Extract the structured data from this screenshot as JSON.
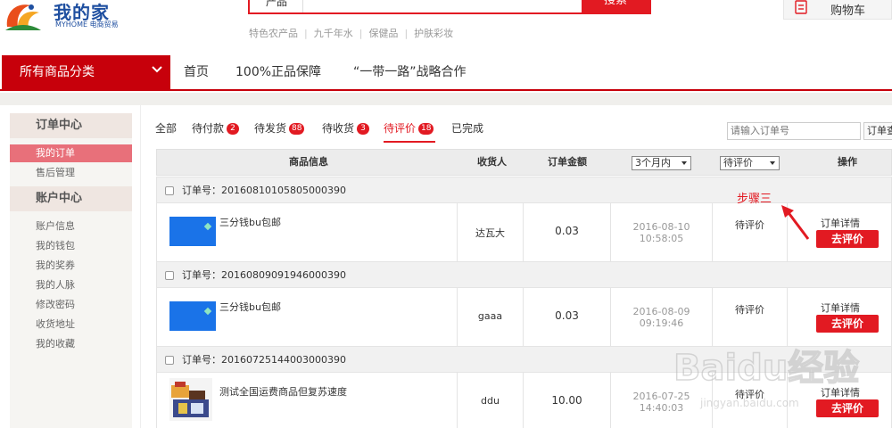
{
  "header": {
    "logo_name": "我的家",
    "logo_sub": "MYHOME 电商贸易",
    "search_category": "产品",
    "search_button": "搜索",
    "hotwords": [
      "特色农产品",
      "九千年水",
      "保健品",
      "护肤彩妆"
    ],
    "cart_label": "购物车"
  },
  "nav": {
    "all_categories": "所有商品分类",
    "links": [
      "首页",
      "100%正品保障",
      "“一带一路”战略合作"
    ]
  },
  "sidebar": {
    "order_center": "订单中心",
    "order_items": [
      "我的订单",
      "售后管理"
    ],
    "account_center": "账户中心",
    "account_items": [
      "账户信息",
      "我的钱包",
      "我的奖券",
      "我的人脉",
      "修改密码",
      "收货地址",
      "我的收藏"
    ]
  },
  "tabs": [
    {
      "label": "全部",
      "badge": ""
    },
    {
      "label": "待付款",
      "badge": "2"
    },
    {
      "label": "待发货",
      "badge": "88"
    },
    {
      "label": "待收货",
      "badge": "3"
    },
    {
      "label": "待评价",
      "badge": "18"
    },
    {
      "label": "已完成",
      "badge": ""
    }
  ],
  "order_search": {
    "placeholder": "请输入订单号",
    "button": "订单查"
  },
  "table_head": {
    "product": "商品信息",
    "receiver": "收货人",
    "amount": "订单金额",
    "time_filter": "3个月内",
    "status_filter": "待评价",
    "action": "操作"
  },
  "orders": [
    {
      "order_no": "订单号：20160810105805000390",
      "product": "三分钱bu包邮",
      "receiver": "达瓦大",
      "amount": "0.03",
      "date": "2016-08-10",
      "time": "10:58:05",
      "status": "待评价",
      "detail": "订单详情",
      "rate": "去评价"
    },
    {
      "order_no": "订单号：20160809091946000390",
      "product": "三分钱bu包邮",
      "receiver": "gaaa",
      "amount": "0.03",
      "date": "2016-08-09",
      "time": "09:19:46",
      "status": "待评价",
      "detail": "订单详情",
      "rate": "去评价"
    },
    {
      "order_no": "订单号：20160725144003000390",
      "product": "测试全国运费商品但复苏速度",
      "receiver": "ddu",
      "amount": "10.00",
      "date": "2016-07-25",
      "time": "14:40:03",
      "status": "待评价",
      "detail": "订单详情",
      "rate": "去评价"
    }
  ],
  "annotation": "步骤三",
  "watermark_text": "Baidu经验",
  "watermark_url": "jingyan.baidu.com",
  "colors": {
    "accent": "#e21a22",
    "nav_red": "#c7000b",
    "active_side": "#e8707a"
  }
}
